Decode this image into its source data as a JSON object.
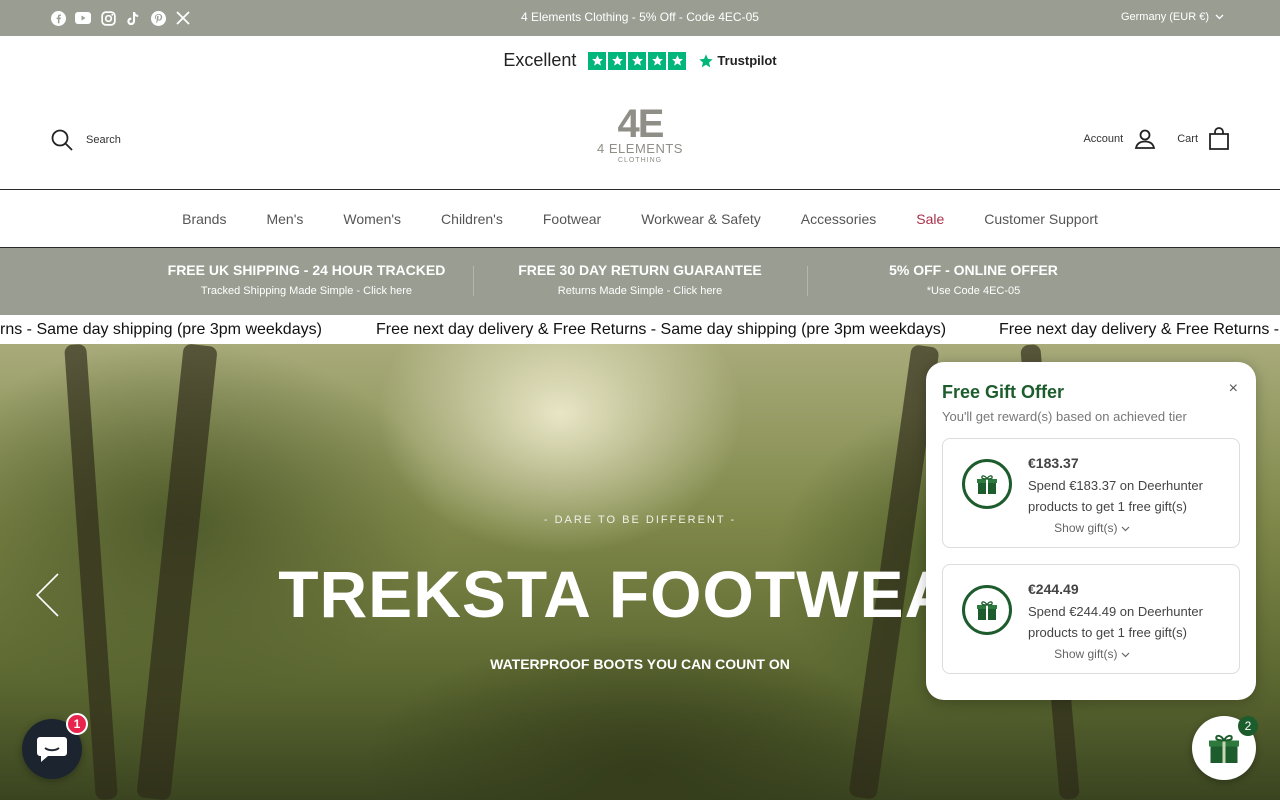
{
  "topbar": {
    "socials": [
      "facebook-icon",
      "youtube-icon",
      "instagram-icon",
      "tiktok-icon",
      "pinterest-icon",
      "x-icon"
    ],
    "promo": "4 Elements Clothing - 5% Off - Code 4EC-05",
    "region": "Germany (EUR €)"
  },
  "trustpilot": {
    "rating_word": "Excellent",
    "stars": 5,
    "brand": "Trustpilot"
  },
  "header": {
    "search_label": "Search",
    "logo": {
      "mark": "4E",
      "name": "4 ELEMENTS",
      "sub": "CLOTHING"
    },
    "account_label": "Account",
    "cart_label": "Cart"
  },
  "nav": {
    "items": [
      "Brands",
      "Men's",
      "Women's",
      "Children's",
      "Footwear",
      "Workwear & Safety",
      "Accessories",
      "Sale",
      "Customer Support"
    ]
  },
  "benefits": [
    {
      "title": "FREE UK SHIPPING - 24 HOUR TRACKED",
      "sub": "Tracked Shipping Made Simple - Click here"
    },
    {
      "title": "FREE 30 DAY RETURN GUARANTEE",
      "sub": "Returns Made Simple - Click here"
    },
    {
      "title": "5% OFF - ONLINE OFFER",
      "sub": "*Use Code 4EC-05"
    }
  ],
  "marquee": {
    "text_1": "rns - Same day shipping (pre 3pm weekdays)",
    "text_2": "Free next day delivery & Free Returns - Same day shipping (pre 3pm weekdays)",
    "text_3": "Free next day delivery & Free Returns -"
  },
  "hero": {
    "eyebrow": "- DARE TO BE DIFFERENT -",
    "title": "TREKSTA FOOTWEAR",
    "subtitle": "WATERPROOF BOOTS YOU CAN COUNT ON"
  },
  "gift_popup": {
    "title": "Free Gift Offer",
    "subtitle": "You'll get reward(s) based on achieved tier",
    "close": "×",
    "tiers": [
      {
        "amount": "€183.37",
        "desc": "Spend €183.37 on Deerhunter products to get 1 free gift(s)",
        "show": "Show gift(s)"
      },
      {
        "amount": "€244.49",
        "desc": "Spend €244.49 on Deerhunter products to get 1 free gift(s)",
        "show": "Show gift(s)"
      }
    ]
  },
  "chat": {
    "badge": "1"
  },
  "gift_widget": {
    "badge": "2"
  },
  "colors": {
    "sage": "#9a9e92",
    "sale": "#a8314a",
    "gift_green": "#1d5c2c",
    "trust_green": "#00b67a"
  }
}
